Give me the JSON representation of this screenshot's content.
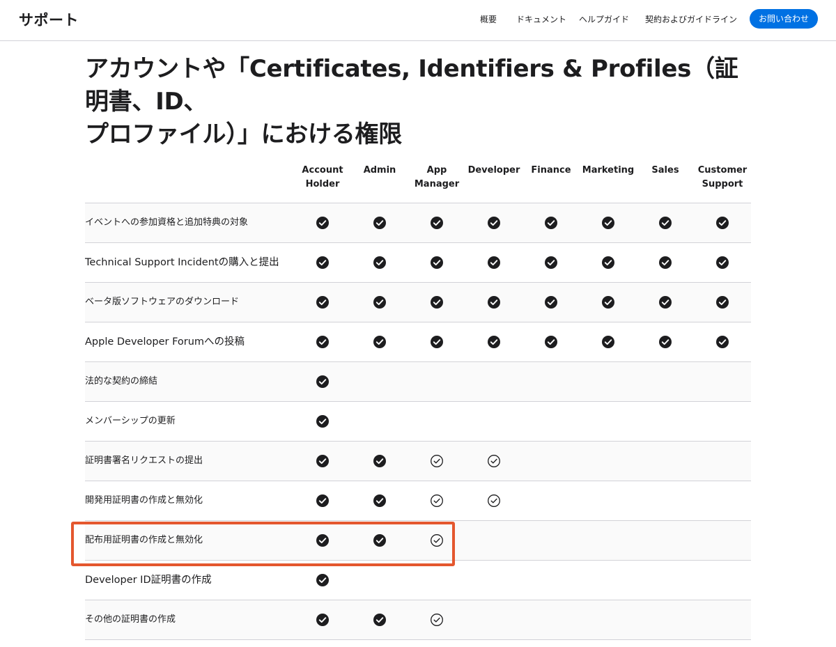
{
  "header": {
    "brand": "サポート",
    "nav": [
      "概要",
      "ドキュメント",
      "ヘルプガイド",
      "契約およびガイドライン"
    ],
    "contact_button": "お問い合わせ"
  },
  "page": {
    "title_line1": "アカウントや「Certificates, Identifiers & Profiles（証明書、ID、",
    "title_line2": "プロファイル）」における権限"
  },
  "table": {
    "columns": [
      "Account\nHolder",
      "Admin",
      "App\nManager",
      "Developer",
      "Finance",
      "Marketing",
      "Sales",
      "Customer\nSupport"
    ],
    "legend_values": {
      "full": "filled check",
      "partial": "outline check",
      "none": "empty"
    },
    "rows": [
      {
        "label": "イベントへの参加資格と追加特典の対象",
        "cells": [
          "full",
          "full",
          "full",
          "full",
          "full",
          "full",
          "full",
          "full"
        ]
      },
      {
        "label": "Technical Support Incidentの購入と提出",
        "cells": [
          "full",
          "full",
          "full",
          "full",
          "full",
          "full",
          "full",
          "full"
        ]
      },
      {
        "label": "ベータ版ソフトウェアのダウンロード",
        "cells": [
          "full",
          "full",
          "full",
          "full",
          "full",
          "full",
          "full",
          "full"
        ]
      },
      {
        "label": "Apple Developer Forumへの投稿",
        "cells": [
          "full",
          "full",
          "full",
          "full",
          "full",
          "full",
          "full",
          "full"
        ]
      },
      {
        "label": "法的な契約の締結",
        "cells": [
          "full",
          "none",
          "none",
          "none",
          "none",
          "none",
          "none",
          "none"
        ]
      },
      {
        "label": "メンバーシップの更新",
        "cells": [
          "full",
          "none",
          "none",
          "none",
          "none",
          "none",
          "none",
          "none"
        ]
      },
      {
        "label": "証明書署名リクエストの提出",
        "cells": [
          "full",
          "full",
          "partial",
          "partial",
          "none",
          "none",
          "none",
          "none"
        ]
      },
      {
        "label": "開発用証明書の作成と無効化",
        "cells": [
          "full",
          "full",
          "partial",
          "partial",
          "none",
          "none",
          "none",
          "none"
        ]
      },
      {
        "label": "配布用証明書の作成と無効化",
        "cells": [
          "full",
          "full",
          "partial",
          "none",
          "none",
          "none",
          "none",
          "none"
        ],
        "highlighted": true
      },
      {
        "label": "Developer ID証明書の作成",
        "cells": [
          "full",
          "none",
          "none",
          "none",
          "none",
          "none",
          "none",
          "none"
        ]
      },
      {
        "label": "その他の証明書の作成",
        "cells": [
          "full",
          "full",
          "partial",
          "none",
          "none",
          "none",
          "none",
          "none"
        ]
      }
    ]
  },
  "colors": {
    "accent": "#0071e3",
    "highlight": "#e4572e",
    "check": "#1d1d1f"
  }
}
